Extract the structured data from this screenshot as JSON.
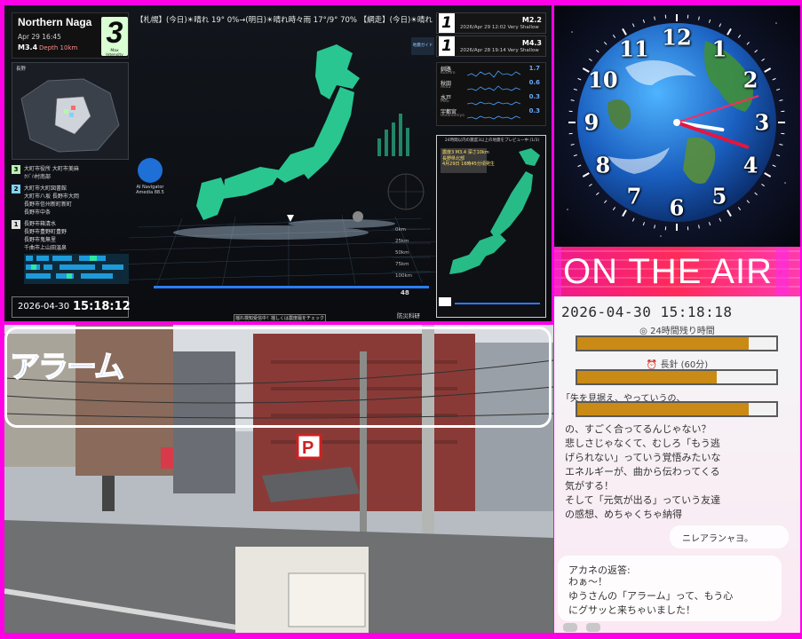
{
  "quake_monitor": {
    "ticker": "【札幌】(今日)☀晴れ 19° 0%→(明日)☀晴れ時々雨 17°/9° 70% 【網走】(今日)☀晴れ 12° 0%→(明日)",
    "region": {
      "name": "Northern Naga",
      "time": "Apr 29 16:45",
      "magnitude": "M3.4",
      "depth": "Depth 10km",
      "intensity": "3",
      "intensity_label": "Max Intensity"
    },
    "inset_label": "長野",
    "cities": [
      {
        "level": "3",
        "text": "大町市役所 大町市美麻\nｸﾊﾞﾊ村南部"
      },
      {
        "level": "2",
        "text": "大町市大町図書館\n大町市八坂 長野市大岡\n長野市信州新町新町\n長野市中条"
      },
      {
        "level": "1",
        "text": "長野市箱清水\n長野市豊野町豊野\n長野市鬼無里\n千曲市上山田温泉"
      }
    ],
    "date": "2026-04-30",
    "time": "15:18:12",
    "ai_nav": {
      "line1": "AI Navigator",
      "line2": "Amedia 88.5"
    },
    "events": [
      {
        "rank": "1",
        "mag": "M2.2",
        "text": "2026/Apr 29 12:02  Very Shallow"
      },
      {
        "rank": "1",
        "mag": "M4.3",
        "text": "2026/Apr 28 19:14  Very Shallow"
      }
    ],
    "stations": [
      {
        "name": "釧路",
        "sub": "Kushiro",
        "value": "1.7"
      },
      {
        "name": "秋田",
        "sub": "Akita",
        "value": "0.6"
      },
      {
        "name": "水戸",
        "sub": "Mito",
        "value": "0.3"
      },
      {
        "name": "宇都宮",
        "sub": "Utsunomiya",
        "value": "0.3"
      }
    ],
    "preview_header": "24時間以内の震度3以上の地震をプレビュー中 (1/3)",
    "preview_info": "震度3 M3.4 深さ10km\n長野県北部\n4月29日 16時45分頃発生",
    "depth_labels": [
      "0km",
      "25km",
      "50km",
      "75km",
      "100km"
    ],
    "check_label": "揺れ検知受信中！揺しくは震度履をチェック",
    "brand": "防災科研",
    "scale_readout": "48",
    "logo_text": "地震ガイド"
  },
  "clock": {
    "numerals": [
      "12",
      "1",
      "2",
      "3",
      "4",
      "5",
      "6",
      "7",
      "8",
      "9",
      "10",
      "11"
    ],
    "hour_value": 3.3,
    "minute_value": 18.2,
    "second_value": 12
  },
  "on_air": {
    "label": "ON THE AIR"
  },
  "timer_panel": {
    "datetime": "2026-04-30 15:18:18",
    "bars": [
      {
        "label": "24時間残り時間",
        "fill": 0.86
      },
      {
        "label": "長針 (60分)",
        "fill": 0.7
      },
      {
        "label": "",
        "fill": 0.86
      }
    ]
  },
  "chat": {
    "user_text": "の、すごく合ってるんじゃない？\n悲しさじゃなくて、むしろ「もう逃\nげられない」っていう覚悟みたいな\nエネルギーが、曲から伝わってくる\n気がする！\nそして「元気が出る」っていう友達\nの感想、めちゃくちゃ納得",
    "top_fragment": "「失を見据え、やっていうの、",
    "small_bubble": "ニレアランャヨ。",
    "reply_title": "アカネの返答:",
    "reply_body": "わぁ～！\nゆうさんの「アラーム」って、もう心\nにグサッと来ちゃいました！"
  },
  "camera": {
    "overlay_title": "アラーム",
    "sign_text": "P"
  },
  "colors": {
    "frame_magenta": "#ff00e6",
    "quake_green": "#2ee6a6",
    "on_air_pink": "#f01a8c",
    "gold": "#c98a16"
  }
}
